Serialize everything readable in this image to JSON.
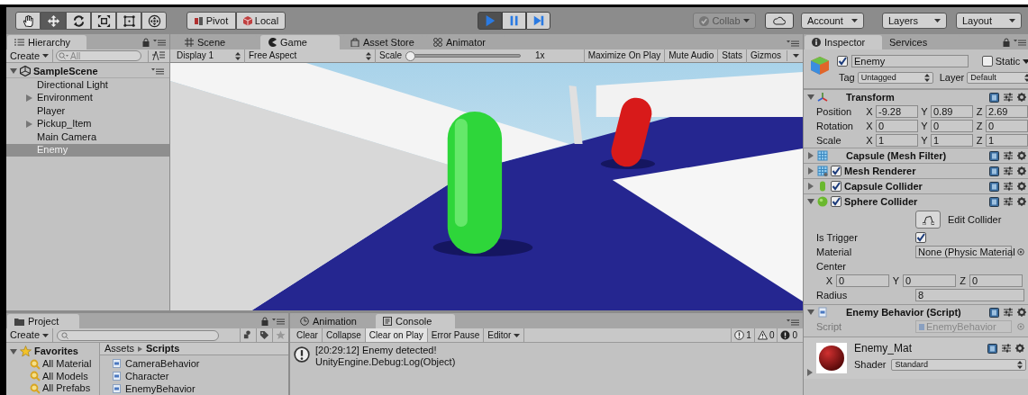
{
  "toolbar": {
    "tools": [
      {
        "kind": "hand",
        "selected": false
      },
      {
        "kind": "move",
        "selected": true
      },
      {
        "kind": "rotate",
        "selected": false
      },
      {
        "kind": "scale",
        "selected": false
      },
      {
        "kind": "rect",
        "selected": false
      },
      {
        "kind": "transform",
        "selected": false
      }
    ],
    "handles": [
      {
        "kind": "pivot",
        "label": "Pivot"
      },
      {
        "kind": "local",
        "label": "Local"
      }
    ],
    "playback": [
      {
        "kind": "play",
        "selected": true
      },
      {
        "kind": "pause",
        "selected": false
      },
      {
        "kind": "step",
        "selected": false
      }
    ],
    "collab": "Collab",
    "account": "Account",
    "layers": "Layers",
    "layout": "Layout"
  },
  "hierarchy": {
    "tab": "Hierarchy",
    "create": "Create",
    "search_placeholder": "All",
    "scene": {
      "name": "SampleScene",
      "expanded": true,
      "children": [
        {
          "name": "Directional Light",
          "kind": "object",
          "selected": false
        },
        {
          "name": "Environment",
          "kind": "group",
          "selected": false
        },
        {
          "name": "Player",
          "kind": "object",
          "selected": false
        },
        {
          "name": "Pickup_Item",
          "kind": "group",
          "selected": false
        },
        {
          "name": "Main Camera",
          "kind": "object",
          "selected": false
        },
        {
          "name": "Enemy",
          "kind": "object",
          "selected": true
        }
      ]
    }
  },
  "game": {
    "tabs": [
      {
        "kind": "scene",
        "label": "Scene",
        "selected": false
      },
      {
        "kind": "game",
        "label": "Game",
        "selected": true
      },
      {
        "kind": "store",
        "label": "Asset Store",
        "selected": false
      },
      {
        "kind": "animator",
        "label": "Animator",
        "selected": false
      }
    ],
    "toolbar": {
      "display": "Display 1",
      "aspect": "Free Aspect",
      "scale_label": "Scale",
      "scale": {
        "level": 0
      },
      "scale_reading": "1x",
      "buttons": [
        {
          "kind": "toggle",
          "label": "Maximize On Play"
        },
        {
          "kind": "toggle",
          "label": "Mute Audio"
        },
        {
          "kind": "toggle",
          "label": "Stats"
        },
        {
          "kind": "dropdown",
          "label": "Gizmos"
        }
      ]
    }
  },
  "inspector": {
    "tabs": [
      {
        "kind": "inspector",
        "label": "Inspector",
        "selected": true
      },
      {
        "kind": "services",
        "label": "Services",
        "selected": false
      }
    ],
    "object": {
      "active": true,
      "name": "Enemy",
      "static_label": "Static",
      "static": false,
      "tag_label": "Tag",
      "tag": "Untagged",
      "layer_label": "Layer",
      "layer": "Default"
    },
    "components": [
      {
        "kind": "transform",
        "name": "Transform",
        "expanded": true,
        "rows": [
          {
            "label": "Position",
            "values": [
              {
                "axis": "X",
                "value": "-9.28"
              },
              {
                "axis": "Y",
                "value": "0.89"
              },
              {
                "axis": "Z",
                "value": "2.69"
              }
            ]
          },
          {
            "label": "Rotation",
            "values": [
              {
                "axis": "X",
                "value": "0"
              },
              {
                "axis": "Y",
                "value": "0"
              },
              {
                "axis": "Z",
                "value": "0"
              }
            ]
          },
          {
            "label": "Scale",
            "values": [
              {
                "axis": "X",
                "value": "1"
              },
              {
                "axis": "Y",
                "value": "1"
              },
              {
                "axis": "Z",
                "value": "1"
              }
            ]
          }
        ]
      },
      {
        "kind": "mesh_filter",
        "name": "Capsule (Mesh Filter)",
        "expanded": false
      },
      {
        "kind": "mesh_renderer",
        "name": "Mesh Renderer",
        "expanded": false,
        "enabled": true
      },
      {
        "kind": "capsule_collider",
        "name": "Capsule Collider",
        "expanded": false,
        "enabled": true
      },
      {
        "kind": "sphere_collider",
        "name": "Sphere Collider",
        "expanded": true,
        "enabled": true,
        "edit_button": "Edit Collider",
        "is_trigger_label": "Is Trigger",
        "is_trigger": true,
        "material_label": "Material",
        "material": "None (Physic Material",
        "center_label": "Center",
        "center": [
          {
            "axis": "X",
            "value": "0"
          },
          {
            "axis": "Y",
            "value": "0"
          },
          {
            "axis": "Z",
            "value": "0"
          }
        ],
        "radius_label": "Radius",
        "radius": "8"
      },
      {
        "kind": "script",
        "name": "Enemy Behavior (Script)",
        "expanded": true,
        "script_label": "Script",
        "script": "EnemyBehavior"
      },
      {
        "kind": "material",
        "name": "Enemy_Mat",
        "expanded": false,
        "shader_label": "Shader",
        "shader": "Standard"
      }
    ]
  },
  "project": {
    "tab": "Project",
    "create": "Create",
    "favorites": {
      "label": "Favorites",
      "expanded": true,
      "items": [
        "All Material",
        "All Models",
        "All Prefabs"
      ]
    },
    "breadcrumb": [
      "Assets",
      "Scripts"
    ],
    "files": [
      "CameraBehavior",
      "Character",
      "EnemyBehavior"
    ]
  },
  "console": {
    "tabs": [
      {
        "kind": "animation",
        "label": "Animation",
        "selected": false
      },
      {
        "kind": "console",
        "label": "Console",
        "selected": true
      }
    ],
    "buttons": [
      {
        "kind": "toggle",
        "label": "Clear",
        "selected": false
      },
      {
        "kind": "toggle",
        "label": "Collapse",
        "selected": false
      },
      {
        "kind": "toggle",
        "label": "Clear on Play",
        "selected": true
      },
      {
        "kind": "toggle",
        "label": "Error Pause",
        "selected": false
      },
      {
        "kind": "dropdown",
        "label": "Editor",
        "selected": false
      }
    ],
    "counts": [
      {
        "kind": "info",
        "count": "1"
      },
      {
        "kind": "warning",
        "count": "0"
      },
      {
        "kind": "error",
        "count": "0"
      }
    ],
    "log": [
      {
        "kind": "info",
        "message": "[20:29:12] Enemy detected!",
        "trace": "UnityEngine.Debug:Log(Object)"
      }
    ]
  }
}
